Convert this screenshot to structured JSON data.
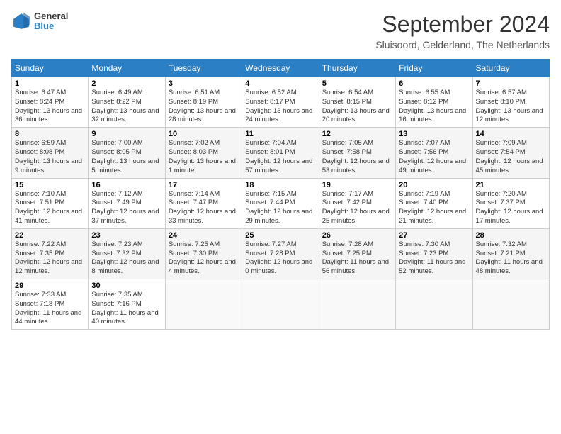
{
  "header": {
    "logo": {
      "general": "General",
      "blue": "Blue"
    },
    "title": "September 2024",
    "location": "Sluisoord, Gelderland, The Netherlands"
  },
  "calendar": {
    "days_of_week": [
      "Sunday",
      "Monday",
      "Tuesday",
      "Wednesday",
      "Thursday",
      "Friday",
      "Saturday"
    ],
    "weeks": [
      [
        null,
        {
          "day": "2",
          "sunrise": "Sunrise: 6:49 AM",
          "sunset": "Sunset: 8:22 PM",
          "daylight": "Daylight: 13 hours and 32 minutes."
        },
        {
          "day": "3",
          "sunrise": "Sunrise: 6:51 AM",
          "sunset": "Sunset: 8:19 PM",
          "daylight": "Daylight: 13 hours and 28 minutes."
        },
        {
          "day": "4",
          "sunrise": "Sunrise: 6:52 AM",
          "sunset": "Sunset: 8:17 PM",
          "daylight": "Daylight: 13 hours and 24 minutes."
        },
        {
          "day": "5",
          "sunrise": "Sunrise: 6:54 AM",
          "sunset": "Sunset: 8:15 PM",
          "daylight": "Daylight: 13 hours and 20 minutes."
        },
        {
          "day": "6",
          "sunrise": "Sunrise: 6:55 AM",
          "sunset": "Sunset: 8:12 PM",
          "daylight": "Daylight: 13 hours and 16 minutes."
        },
        {
          "day": "7",
          "sunrise": "Sunrise: 6:57 AM",
          "sunset": "Sunset: 8:10 PM",
          "daylight": "Daylight: 13 hours and 12 minutes."
        }
      ],
      [
        {
          "day": "1",
          "sunrise": "Sunrise: 6:47 AM",
          "sunset": "Sunset: 8:24 PM",
          "daylight": "Daylight: 13 hours and 36 minutes."
        },
        null,
        null,
        null,
        null,
        null,
        null
      ],
      [
        {
          "day": "8",
          "sunrise": "Sunrise: 6:59 AM",
          "sunset": "Sunset: 8:08 PM",
          "daylight": "Daylight: 13 hours and 9 minutes."
        },
        {
          "day": "9",
          "sunrise": "Sunrise: 7:00 AM",
          "sunset": "Sunset: 8:05 PM",
          "daylight": "Daylight: 13 hours and 5 minutes."
        },
        {
          "day": "10",
          "sunrise": "Sunrise: 7:02 AM",
          "sunset": "Sunset: 8:03 PM",
          "daylight": "Daylight: 13 hours and 1 minute."
        },
        {
          "day": "11",
          "sunrise": "Sunrise: 7:04 AM",
          "sunset": "Sunset: 8:01 PM",
          "daylight": "Daylight: 12 hours and 57 minutes."
        },
        {
          "day": "12",
          "sunrise": "Sunrise: 7:05 AM",
          "sunset": "Sunset: 7:58 PM",
          "daylight": "Daylight: 12 hours and 53 minutes."
        },
        {
          "day": "13",
          "sunrise": "Sunrise: 7:07 AM",
          "sunset": "Sunset: 7:56 PM",
          "daylight": "Daylight: 12 hours and 49 minutes."
        },
        {
          "day": "14",
          "sunrise": "Sunrise: 7:09 AM",
          "sunset": "Sunset: 7:54 PM",
          "daylight": "Daylight: 12 hours and 45 minutes."
        }
      ],
      [
        {
          "day": "15",
          "sunrise": "Sunrise: 7:10 AM",
          "sunset": "Sunset: 7:51 PM",
          "daylight": "Daylight: 12 hours and 41 minutes."
        },
        {
          "day": "16",
          "sunrise": "Sunrise: 7:12 AM",
          "sunset": "Sunset: 7:49 PM",
          "daylight": "Daylight: 12 hours and 37 minutes."
        },
        {
          "day": "17",
          "sunrise": "Sunrise: 7:14 AM",
          "sunset": "Sunset: 7:47 PM",
          "daylight": "Daylight: 12 hours and 33 minutes."
        },
        {
          "day": "18",
          "sunrise": "Sunrise: 7:15 AM",
          "sunset": "Sunset: 7:44 PM",
          "daylight": "Daylight: 12 hours and 29 minutes."
        },
        {
          "day": "19",
          "sunrise": "Sunrise: 7:17 AM",
          "sunset": "Sunset: 7:42 PM",
          "daylight": "Daylight: 12 hours and 25 minutes."
        },
        {
          "day": "20",
          "sunrise": "Sunrise: 7:19 AM",
          "sunset": "Sunset: 7:40 PM",
          "daylight": "Daylight: 12 hours and 21 minutes."
        },
        {
          "day": "21",
          "sunrise": "Sunrise: 7:20 AM",
          "sunset": "Sunset: 7:37 PM",
          "daylight": "Daylight: 12 hours and 17 minutes."
        }
      ],
      [
        {
          "day": "22",
          "sunrise": "Sunrise: 7:22 AM",
          "sunset": "Sunset: 7:35 PM",
          "daylight": "Daylight: 12 hours and 12 minutes."
        },
        {
          "day": "23",
          "sunrise": "Sunrise: 7:23 AM",
          "sunset": "Sunset: 7:32 PM",
          "daylight": "Daylight: 12 hours and 8 minutes."
        },
        {
          "day": "24",
          "sunrise": "Sunrise: 7:25 AM",
          "sunset": "Sunset: 7:30 PM",
          "daylight": "Daylight: 12 hours and 4 minutes."
        },
        {
          "day": "25",
          "sunrise": "Sunrise: 7:27 AM",
          "sunset": "Sunset: 7:28 PM",
          "daylight": "Daylight: 12 hours and 0 minutes."
        },
        {
          "day": "26",
          "sunrise": "Sunrise: 7:28 AM",
          "sunset": "Sunset: 7:25 PM",
          "daylight": "Daylight: 11 hours and 56 minutes."
        },
        {
          "day": "27",
          "sunrise": "Sunrise: 7:30 AM",
          "sunset": "Sunset: 7:23 PM",
          "daylight": "Daylight: 11 hours and 52 minutes."
        },
        {
          "day": "28",
          "sunrise": "Sunrise: 7:32 AM",
          "sunset": "Sunset: 7:21 PM",
          "daylight": "Daylight: 11 hours and 48 minutes."
        }
      ],
      [
        {
          "day": "29",
          "sunrise": "Sunrise: 7:33 AM",
          "sunset": "Sunset: 7:18 PM",
          "daylight": "Daylight: 11 hours and 44 minutes."
        },
        {
          "day": "30",
          "sunrise": "Sunrise: 7:35 AM",
          "sunset": "Sunset: 7:16 PM",
          "daylight": "Daylight: 11 hours and 40 minutes."
        },
        null,
        null,
        null,
        null,
        null
      ]
    ]
  }
}
